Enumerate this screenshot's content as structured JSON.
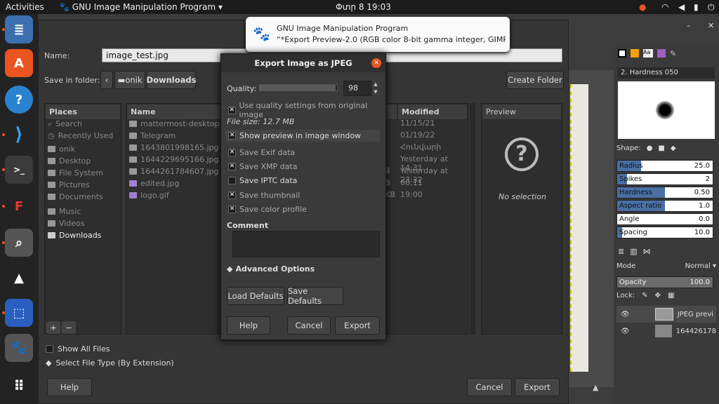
{
  "topbar": {
    "activities": "Activities",
    "app": "GNU Image Manipulation Program",
    "clock": "Փտր 8  19:03"
  },
  "notification": {
    "title": "GNU Image Manipulation Program",
    "body": "“*Export Preview-2.0 (RGB color 8-bit gamma integer, GIMP b…"
  },
  "save": {
    "name_label": "Name:",
    "name_value": "image_test.jpg",
    "folder_label": "Save in folder:",
    "crumb1": "onik",
    "crumb2": "Downloads",
    "create_folder": "Create Folder"
  },
  "places": {
    "header": "Places",
    "items": [
      "Search",
      "Recently Used",
      "onik",
      "Desktop",
      "File System",
      "Pictures",
      "Documents",
      "Music",
      "Videos",
      "Downloads"
    ]
  },
  "files": {
    "name_header": "Name",
    "modified_header": "Modified",
    "names": [
      "mattermost-desktop-5",
      "Telegram",
      "1643801998165.jpg",
      "1644229695166.jpg",
      "1644261784607.jpg",
      "edited.jpg",
      "logo.gif"
    ],
    "sizes": [
      "",
      "",
      "",
      "",
      "B",
      "B",
      "KB",
      ""
    ],
    "modified": [
      "11/15/21",
      "01/19/22",
      "Հունվարի",
      "Yesterday at 14:31",
      "Yesterday at 23:32",
      "00:11",
      "19:00"
    ]
  },
  "preview": {
    "header": "Preview",
    "text": "No selection"
  },
  "bottom": {
    "show_all": "Show All Files",
    "file_type": "Select File Type (By Extension)",
    "help": "Help",
    "cancel": "Cancel",
    "export": "Export"
  },
  "jpeg": {
    "title": "Export Image as JPEG",
    "quality_label": "Quality:",
    "quality_value": "98",
    "quality_fraction": 0.98,
    "use_quality": "Use quality settings from original image",
    "file_size": "File size: 12.7 MB",
    "show_preview": "Show preview in image window",
    "exif": "Save Exif data",
    "xmp": "Save XMP data",
    "iptc": "Save IPTC data",
    "thumb": "Save thumbnail",
    "color": "Save color profile",
    "comment": "Comment",
    "advanced": "Advanced Options",
    "load_defaults": "Load Defaults",
    "save_defaults": "Save Defaults",
    "help": "Help",
    "cancel": "Cancel",
    "export": "Export"
  },
  "brush": {
    "name": "2. Hardness 050",
    "shape": "Shape:",
    "radius": {
      "label": "Radius",
      "value": "25.0",
      "fraction": 0.25
    },
    "spikes": {
      "label": "Spikes",
      "value": "2",
      "fraction": 0.1
    },
    "hardness": {
      "label": "Hardness",
      "value": "0.50",
      "fraction": 0.5
    },
    "aspect": {
      "label": "Aspect ratio",
      "value": "1.0",
      "fraction": 0.5
    },
    "angle": {
      "label": "Angle",
      "value": "0.0",
      "fraction": 0.0
    },
    "spacing": {
      "label": "Spacing",
      "value": "10.0",
      "fraction": 0.05
    }
  },
  "layers": {
    "mode_label": "Mode",
    "mode_value": "Normal",
    "opacity_label": "Opacity",
    "opacity_value": "100.0",
    "lock_label": "Lock:",
    "items": [
      "JPEG previ",
      "164426178"
    ]
  }
}
